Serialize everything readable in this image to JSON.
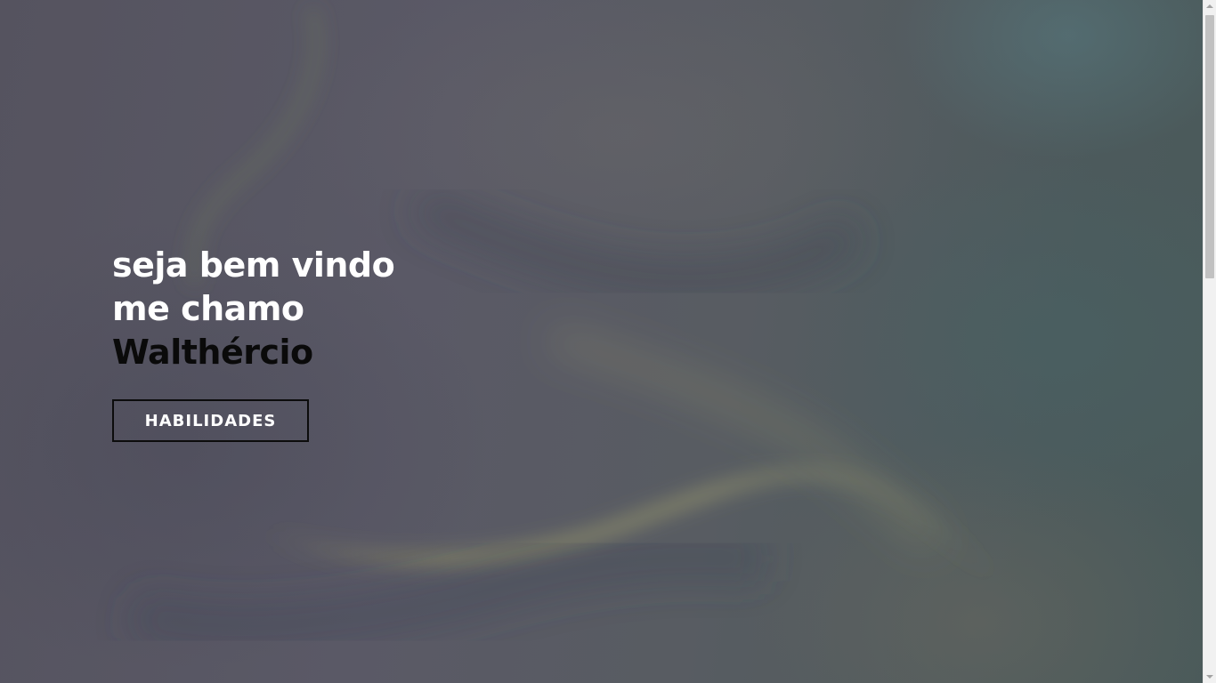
{
  "hero": {
    "greeting_line1": "seja bem vindo",
    "greeting_line2": "me chamo",
    "name": "Walthércio",
    "cta_label": "HABILIDADES"
  },
  "colors": {
    "headline_text": "#ffffff",
    "name_text": "#0a0a0a",
    "button_border": "#0c0c0c",
    "button_text": "#ffffff"
  }
}
